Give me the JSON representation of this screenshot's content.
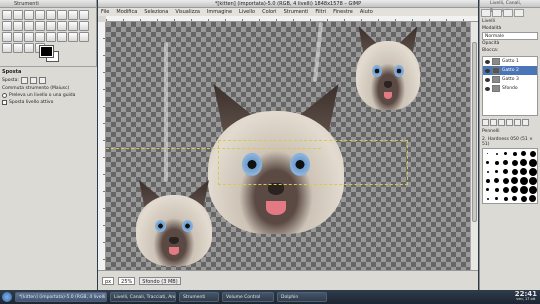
{
  "toolbox": {
    "title": "Strumenti",
    "options_title": "Sposta",
    "move_label": "Sposta:",
    "toggle_label": "Commuta strumento (Maiusc)",
    "option_pick": "Preleva un livello o una guida",
    "option_active": "Sposta livello attivo"
  },
  "image_window": {
    "title": "*[kitten] (importata)-5.0 (RGB, 4 livelli) 1848x1578 – GIMP",
    "menu": [
      "File",
      "Modifica",
      "Seleziona",
      "Visualizza",
      "Immagine",
      "Livello",
      "Colori",
      "Strumenti",
      "Filtri",
      "Finestre",
      "Aiuto"
    ],
    "status": {
      "unit": "px",
      "zoom": "25%",
      "message": "Sfondo (3 MB)"
    }
  },
  "dock": {
    "title": "Livelli, Canali, Tracciati",
    "layers_label": "Livelli",
    "mode_label": "Modalità",
    "mode_value": "Normale",
    "opacity_label": "Opacità",
    "lock_label": "Blocca:",
    "layers": [
      {
        "name": "Gatto 1",
        "selected": false
      },
      {
        "name": "Gatto 2",
        "selected": true
      },
      {
        "name": "Gatto 3",
        "selected": false
      },
      {
        "name": "Sfondo",
        "selected": false
      }
    ],
    "brushes_title": "Pennelli",
    "brush_name": "2. Hardness 050 (51 × 51)"
  },
  "taskbar": {
    "tasks": [
      {
        "label": "*[kitten] (importata)-5.0 (RGB, 4 livelli) 1848x1578 – GIMP",
        "active": true
      },
      {
        "label": "Livelli, Canali, Tracciati, Annulla – Pennelli",
        "active": false
      },
      {
        "label": "Strumenti",
        "active": false
      },
      {
        "label": "Volume Control",
        "active": false
      },
      {
        "label": "Dolphin",
        "active": false
      }
    ],
    "time": "22:41",
    "date": "ven, 17 ott"
  },
  "colors": {
    "accent": "#4a76b8",
    "selection_marquee": "#d7c85a",
    "taskbar": "#1d2632"
  }
}
